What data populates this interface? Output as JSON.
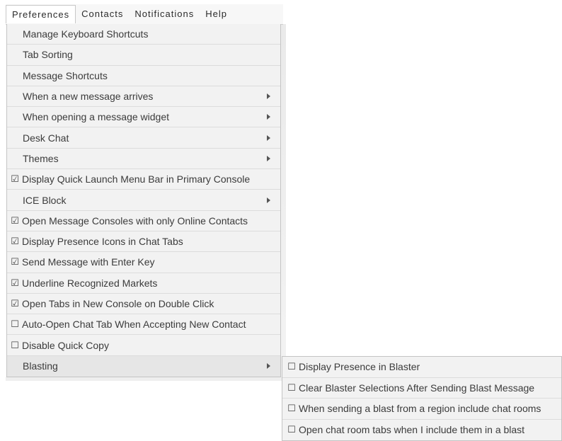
{
  "menubar": {
    "items": [
      {
        "label": "Preferences",
        "open": true
      },
      {
        "label": "Contacts",
        "open": false
      },
      {
        "label": "Notifications",
        "open": false
      },
      {
        "label": "Help",
        "open": false
      }
    ]
  },
  "preferences_menu": {
    "items": [
      {
        "label": "Manage Keyboard Shortcuts",
        "check": null,
        "submenu": false
      },
      {
        "label": "Tab Sorting",
        "check": null,
        "submenu": false
      },
      {
        "label": "Message Shortcuts",
        "check": null,
        "submenu": false
      },
      {
        "label": "When a new message arrives",
        "check": null,
        "submenu": true
      },
      {
        "label": "When opening a message widget",
        "check": null,
        "submenu": true
      },
      {
        "label": "Desk Chat",
        "check": null,
        "submenu": true
      },
      {
        "label": "Themes",
        "check": null,
        "submenu": true
      },
      {
        "label": "Display Quick Launch Menu Bar in Primary Console",
        "check": true,
        "submenu": false
      },
      {
        "label": "ICE Block",
        "check": null,
        "submenu": true
      },
      {
        "label": "Open Message Consoles with only Online Contacts",
        "check": true,
        "submenu": false
      },
      {
        "label": "Display Presence Icons in Chat Tabs",
        "check": true,
        "submenu": false
      },
      {
        "label": "Send Message with Enter Key",
        "check": true,
        "submenu": false
      },
      {
        "label": "Underline Recognized Markets",
        "check": true,
        "submenu": false
      },
      {
        "label": "Open Tabs in New Console on Double Click",
        "check": true,
        "submenu": false
      },
      {
        "label": "Auto-Open Chat Tab When Accepting New Contact",
        "check": false,
        "submenu": false
      },
      {
        "label": "Disable Quick Copy",
        "check": false,
        "submenu": false
      },
      {
        "label": "Blasting",
        "check": null,
        "submenu": true,
        "active": true
      }
    ]
  },
  "blasting_submenu": {
    "items": [
      {
        "label": "Display Presence in Blaster",
        "check": false
      },
      {
        "label": "Clear Blaster Selections After Sending Blast Message",
        "check": false
      },
      {
        "label": "When sending a blast from a region include chat rooms",
        "check": false
      },
      {
        "label": "Open chat room tabs when I include them in a blast",
        "check": false
      }
    ]
  },
  "glyphs": {
    "checked": "☑",
    "unchecked": "☐"
  }
}
